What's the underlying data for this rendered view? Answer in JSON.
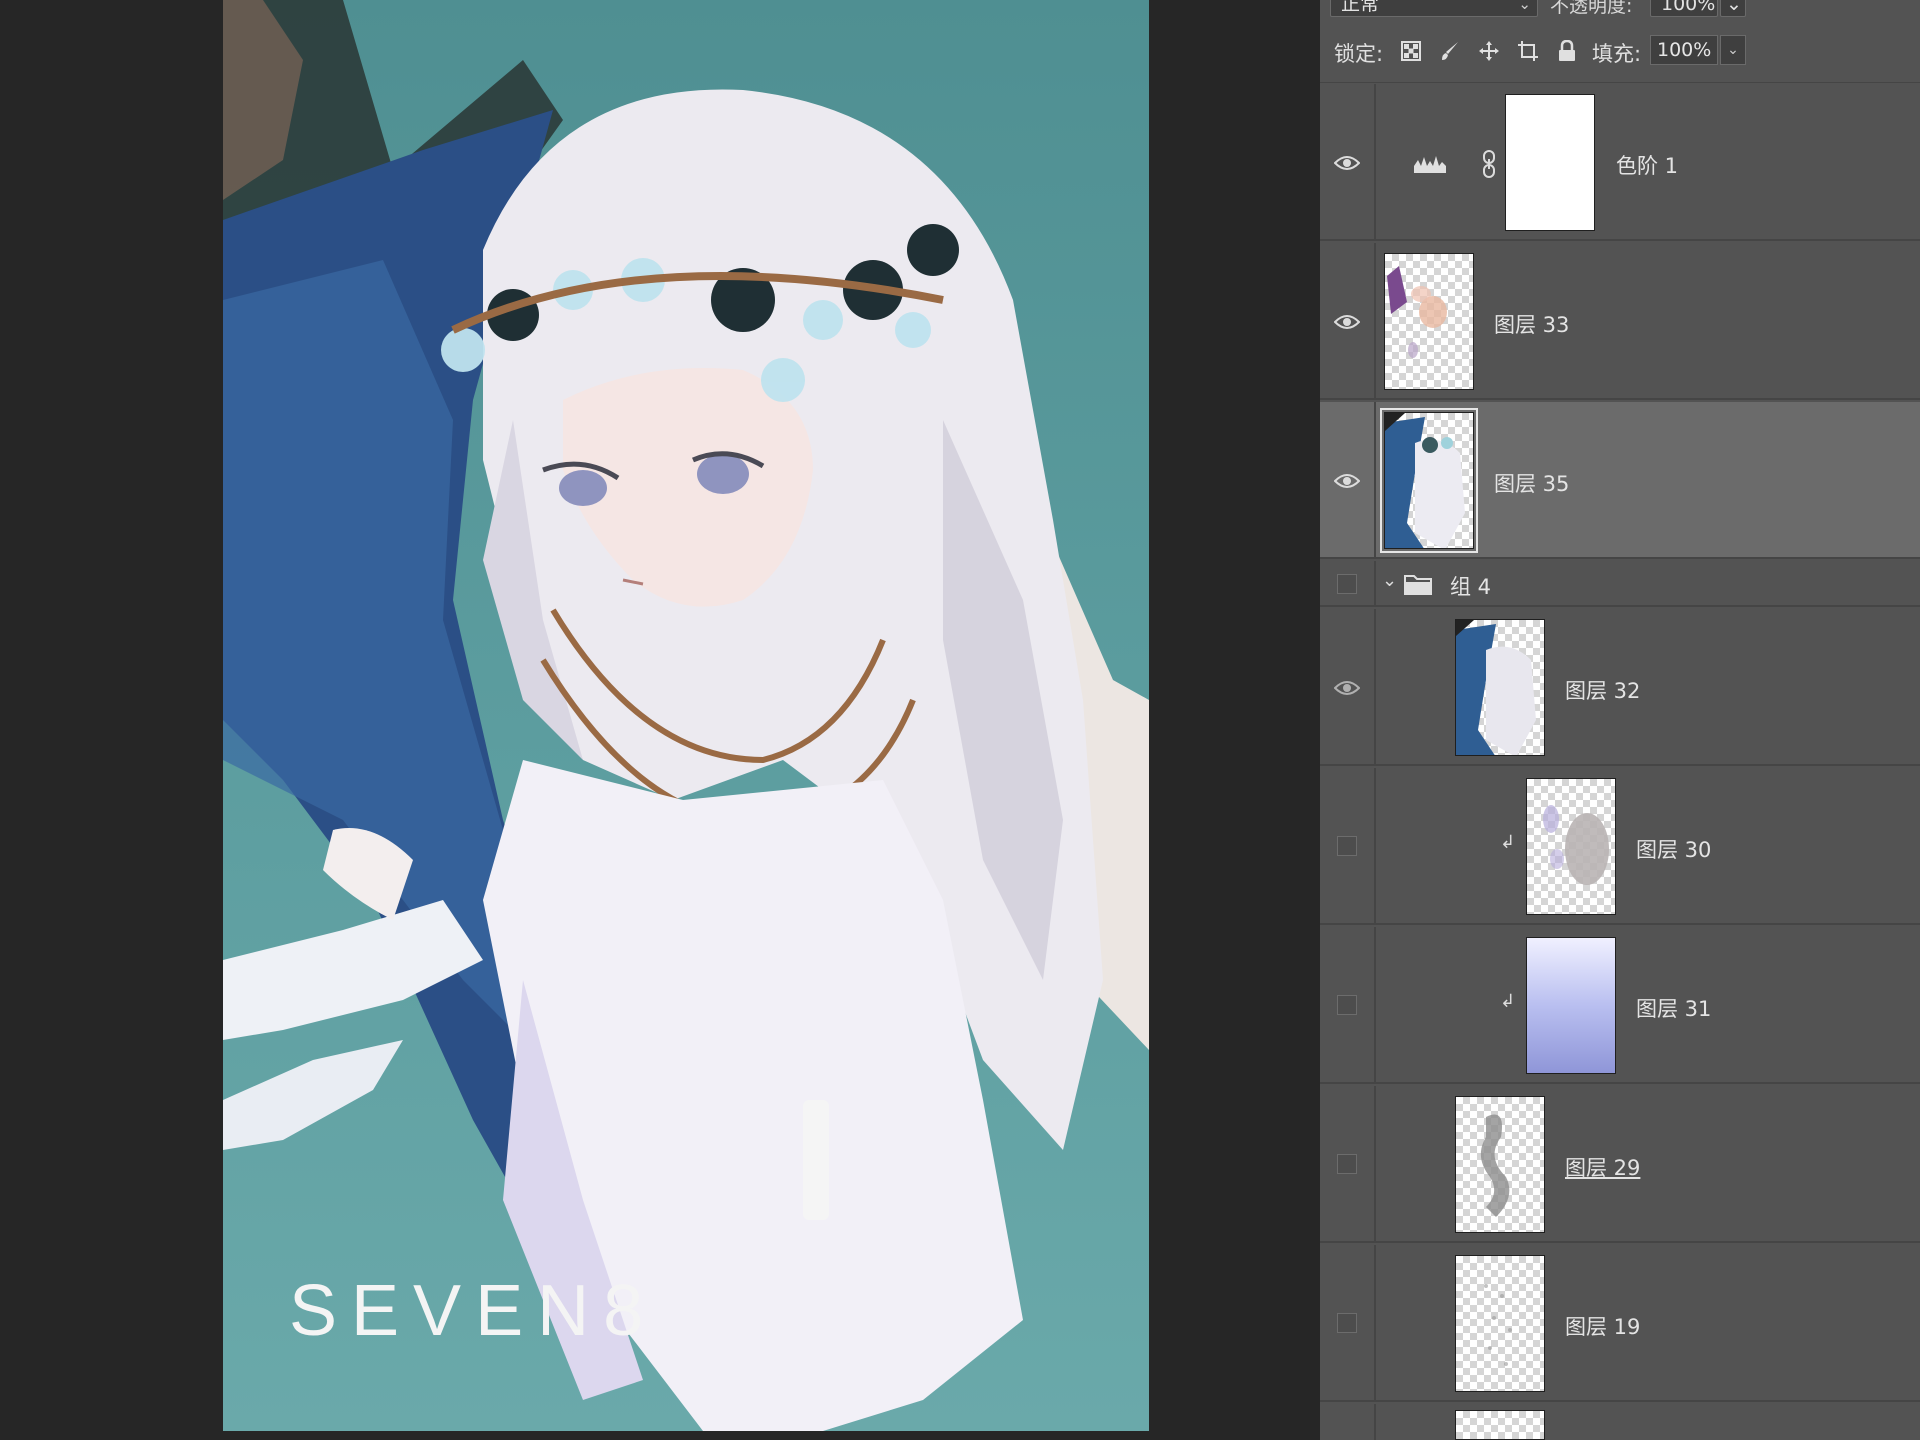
{
  "artwork": {
    "signature": "SEVEN8"
  },
  "layers_panel": {
    "blend_mode": "正常",
    "opacity_label": "不透明度:",
    "opacity_value": "100%",
    "lock_label": "锁定:",
    "fill_label": "填充:",
    "fill_value": "100%",
    "layers": [
      {
        "name": "色阶 1",
        "visible": true,
        "kind": "adjustment-levels"
      },
      {
        "name": "图层 33",
        "visible": true,
        "kind": "pixel"
      },
      {
        "name": "图层 35",
        "visible": true,
        "kind": "pixel",
        "selected": true
      },
      {
        "name": "组 4",
        "visible": false,
        "kind": "group"
      },
      {
        "name": "图层 32",
        "visible": true,
        "kind": "pixel"
      },
      {
        "name": "图层 30",
        "visible": false,
        "kind": "pixel",
        "clipped": true
      },
      {
        "name": "图层 31",
        "visible": false,
        "kind": "pixel",
        "clipped": true
      },
      {
        "name": "图层 29",
        "visible": false,
        "kind": "pixel"
      },
      {
        "name": "图层 19",
        "visible": false,
        "kind": "pixel"
      }
    ]
  },
  "colors": {
    "canvas_background": "#5d9ea0",
    "panel_background": "#535353",
    "selected_row": "#6b6b6b"
  }
}
